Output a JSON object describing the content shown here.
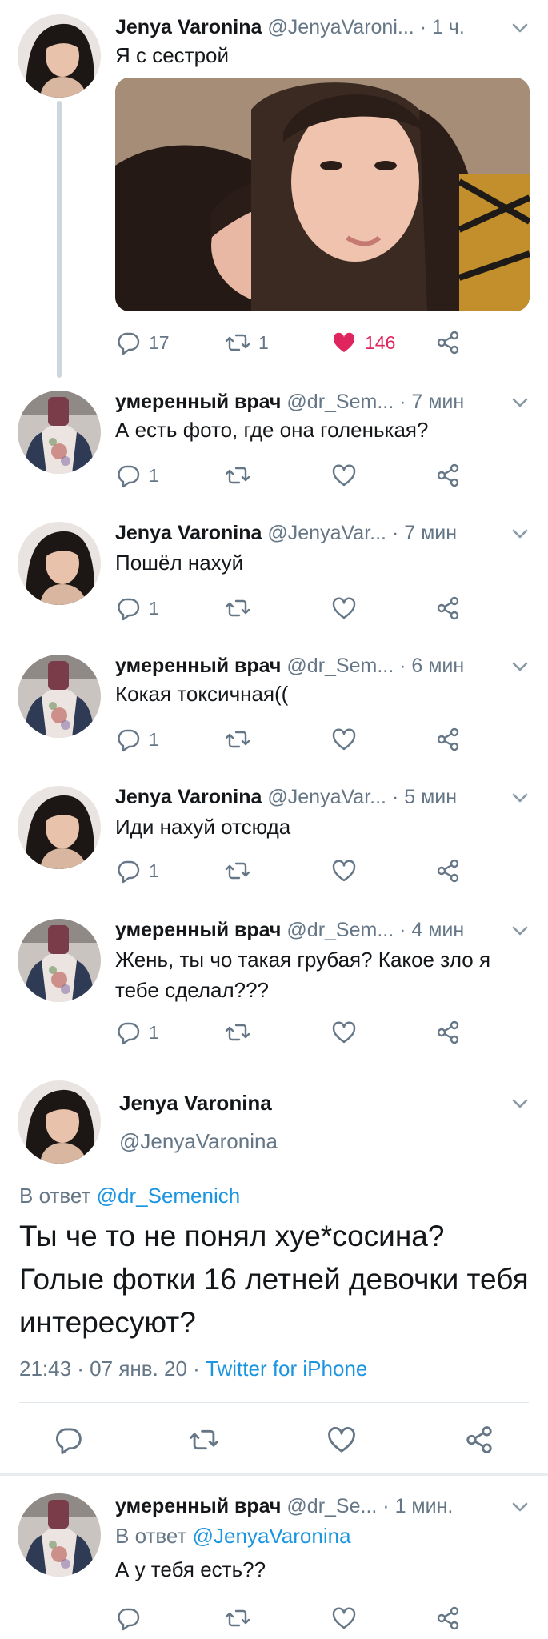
{
  "colors": {
    "accent": "#1b95e0",
    "like": "#e0245e",
    "muted": "#657786",
    "text": "#14171a"
  },
  "tweets": [
    {
      "name": "Jenya Varonina",
      "handle": "@JenyaVaroni...",
      "time": "· 1 ч.",
      "text": "Я с сестрой",
      "replies": "17",
      "retweets": "1",
      "likes": "146",
      "liked": true
    },
    {
      "name": "умеренный врач",
      "handle": "@dr_Sem...",
      "time": "· 7 мин",
      "text": "А есть фото, где она голенькая?",
      "replies": "1"
    },
    {
      "name": "Jenya Varonina",
      "handle": "@JenyaVar...",
      "time": "· 7 мин",
      "text": "Пошёл нахуй",
      "replies": "1"
    },
    {
      "name": "умеренный врач",
      "handle": "@dr_Sem...",
      "time": "· 6 мин",
      "text": "Кокая токсичная((",
      "replies": "1"
    },
    {
      "name": "Jenya Varonina",
      "handle": "@JenyaVar...",
      "time": "· 5 мин",
      "text": "Иди нахуй отсюда",
      "replies": "1"
    },
    {
      "name": "умеренный врач",
      "handle": "@dr_Sem...",
      "time": "· 4 мин",
      "text": "Жень, ты чо такая грубая? Какое зло я тебе сделал???",
      "replies": "1"
    }
  ],
  "main_tweet": {
    "name": "Jenya Varonina",
    "handle": "@JenyaVaronina",
    "reply_prefix": "В ответ",
    "reply_to": "@dr_Semenich",
    "text": "Ты че то не понял хуе*сосина? Голые фотки 16 летней девочки тебя интересуют?",
    "timestamp": "21:43 · 07 янв. 20 ·",
    "source": "Twitter for iPhone"
  },
  "last_reply": {
    "name": "умеренный врач",
    "handle": "@dr_Se...",
    "time": "· 1 мин.",
    "reply_prefix": "В ответ",
    "reply_to": "@JenyaVaronina",
    "text": "А у тебя есть??"
  },
  "icons": [
    "chevron-down-icon",
    "reply-icon",
    "retweet-icon",
    "like-icon",
    "share-icon"
  ]
}
